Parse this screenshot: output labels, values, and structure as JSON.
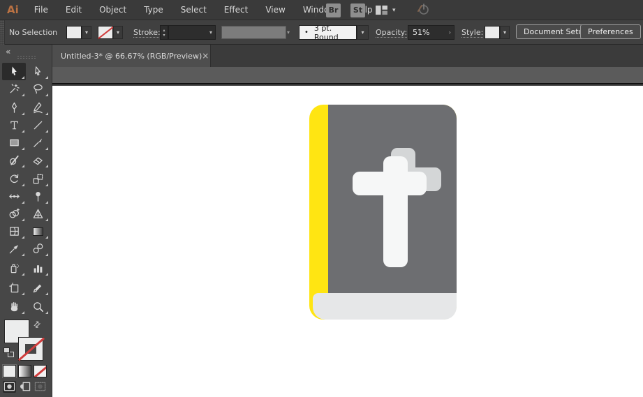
{
  "app": {
    "logo_text": "Ai"
  },
  "menu_bar": {
    "items": [
      "File",
      "Edit",
      "Object",
      "Type",
      "Select",
      "Effect",
      "View",
      "Window",
      "Help"
    ],
    "bridge_label": "Br",
    "stock_label": "St"
  },
  "control_bar": {
    "selection_status": "No Selection",
    "stroke_label": "Stroke:",
    "brush_dot": "•",
    "brush_value": "3 pt. Round",
    "opacity_label": "Opacity:",
    "opacity_value": "51%",
    "opacity_arrow": "›",
    "style_label": "Style:",
    "document_setup_label": "Document Setup",
    "preferences_label": "Preferences",
    "chevron_glyph": "▾",
    "stepper_up": "▴",
    "stepper_down": "▾"
  },
  "document_tab": {
    "title": "Untitled-3* @ 66.67% (RGB/Preview)",
    "close_glyph": "×"
  },
  "toolbox": {
    "collapse_glyph": "«",
    "swap_glyph": "⇄",
    "tools": [
      {
        "name": "selection-tool",
        "active": true
      },
      {
        "name": "direct-selection-tool",
        "active": false
      },
      {
        "name": "magic-wand-tool",
        "active": false
      },
      {
        "name": "lasso-tool",
        "active": false
      },
      {
        "name": "pen-tool",
        "active": false
      },
      {
        "name": "curvature-tool",
        "active": false
      },
      {
        "name": "type-tool",
        "active": false
      },
      {
        "name": "line-segment-tool",
        "active": false
      },
      {
        "name": "rectangle-tool",
        "active": false
      },
      {
        "name": "paintbrush-tool",
        "active": false
      },
      {
        "name": "shaper-tool",
        "active": false
      },
      {
        "name": "eraser-tool",
        "active": false
      },
      {
        "name": "rotate-tool",
        "active": false
      },
      {
        "name": "scale-tool",
        "active": false
      },
      {
        "name": "width-tool",
        "active": false
      },
      {
        "name": "free-transform-tool",
        "active": false
      },
      {
        "name": "shape-builder-tool",
        "active": false
      },
      {
        "name": "perspective-grid-tool",
        "active": false
      },
      {
        "name": "mesh-tool",
        "active": false
      },
      {
        "name": "gradient-tool",
        "active": false
      },
      {
        "name": "eyedropper-tool",
        "active": false
      },
      {
        "name": "blend-tool",
        "active": false
      },
      {
        "name": "symbol-sprayer-tool",
        "active": false
      },
      {
        "name": "column-graph-tool",
        "active": false
      },
      {
        "name": "artboard-tool",
        "active": false
      },
      {
        "name": "slice-tool",
        "active": false
      },
      {
        "name": "hand-tool",
        "active": false
      },
      {
        "name": "zoom-tool",
        "active": false
      }
    ],
    "draw_modes": [
      "draw-normal",
      "draw-behind",
      "draw-inside"
    ],
    "active_draw_mode": "draw-normal"
  },
  "canvas": {
    "artwork": {
      "name": "bible-book-icon",
      "colors": {
        "spine": "#FFE512",
        "cover": "#6D6E71",
        "pages": "#E6E7E8",
        "cross": "#F6F7F7",
        "shadow": "#D4D6D7"
      }
    }
  },
  "colors": {
    "menubar_bg": "#3A3A3A",
    "controlbar_bg": "#404040",
    "toolbox_bg": "#474747",
    "tab_active_bg": "#4E4E4E",
    "pasteboard_bg": "#5B5B5B",
    "artboard_bg": "#FFFFFF",
    "logo_orange": "#BA7243",
    "swatch_none_red": "#D03C3C"
  }
}
